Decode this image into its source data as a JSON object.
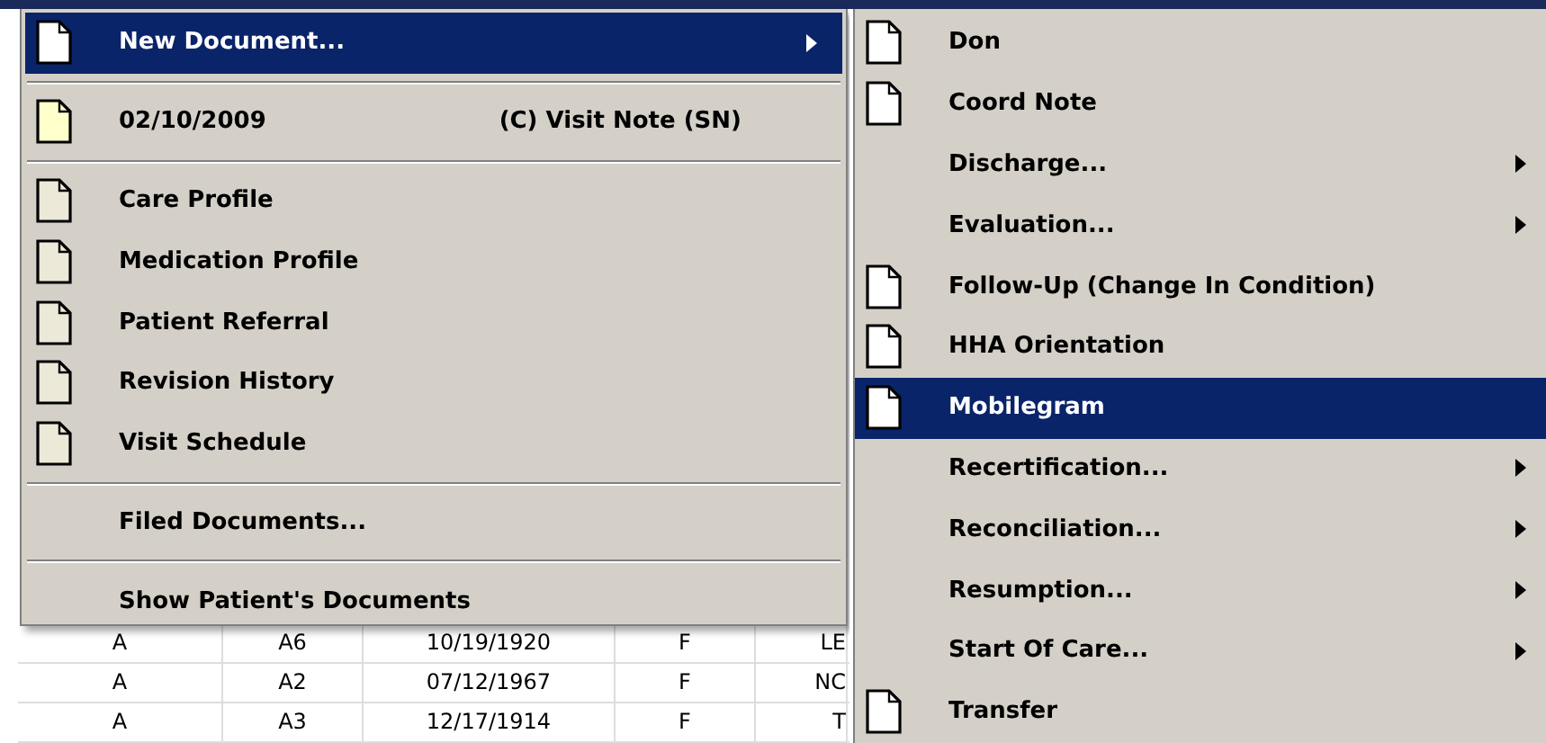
{
  "main_menu": {
    "items": [
      {
        "kind": "item",
        "label": "New Document...",
        "color": "#ffffff",
        "submenu": true,
        "selected": true
      },
      {
        "kind": "separator"
      },
      {
        "kind": "item",
        "label": "02/10/2009",
        "detail": "(C) Visit Note (SN)",
        "color": "#ffffcc",
        "submenu": false,
        "selected": false
      },
      {
        "kind": "separator"
      },
      {
        "kind": "item",
        "label": "Care Profile",
        "color": "#ece9d8",
        "submenu": false,
        "selected": false
      },
      {
        "kind": "item",
        "label": "Medication Profile",
        "color": "#ece9d8",
        "submenu": false,
        "selected": false
      },
      {
        "kind": "item",
        "label": "Patient Referral",
        "color": "#ece9d8",
        "submenu": false,
        "selected": false
      },
      {
        "kind": "item",
        "label": "Revision History",
        "color": "#ece9d8",
        "submenu": false,
        "selected": false
      },
      {
        "kind": "item",
        "label": "Visit Schedule",
        "color": "#ece9d8",
        "submenu": false,
        "selected": false
      },
      {
        "kind": "separator"
      },
      {
        "kind": "item",
        "label": "Filed Documents...",
        "submenu": false,
        "selected": false
      },
      {
        "kind": "separator"
      },
      {
        "kind": "item",
        "label": "Show Patient's Documents",
        "submenu": false,
        "selected": false
      }
    ]
  },
  "submenu": {
    "items": [
      {
        "kind": "item",
        "label": "Don",
        "color": "#ffffff",
        "submenu": false,
        "selected": false
      },
      {
        "kind": "item",
        "label": "Coord Note",
        "color": "#ffffff",
        "submenu": false,
        "selected": false
      },
      {
        "kind": "item",
        "label": "Discharge...",
        "submenu": true,
        "selected": false
      },
      {
        "kind": "item",
        "label": "Evaluation...",
        "submenu": true,
        "selected": false
      },
      {
        "kind": "item",
        "label": "Follow-Up (Change In Condition)",
        "color": "#ffffff",
        "submenu": false,
        "selected": false
      },
      {
        "kind": "item",
        "label": "HHA Orientation",
        "color": "#ffffff",
        "submenu": false,
        "selected": false
      },
      {
        "kind": "item",
        "label": "Mobilegram",
        "color": "#ffffff",
        "submenu": false,
        "selected": true
      },
      {
        "kind": "item",
        "label": "Recertification...",
        "submenu": true,
        "selected": false
      },
      {
        "kind": "item",
        "label": "Reconciliation...",
        "submenu": true,
        "selected": false
      },
      {
        "kind": "item",
        "label": "Resumption...",
        "submenu": true,
        "selected": false
      },
      {
        "kind": "item",
        "label": "Start Of Care...",
        "submenu": true,
        "selected": false
      },
      {
        "kind": "item",
        "label": "Transfer",
        "color": "#ffffff",
        "submenu": false,
        "selected": false
      }
    ]
  },
  "table": {
    "rows": [
      {
        "cells": [
          "A",
          "A6",
          "10/19/1920",
          "F",
          "LE"
        ]
      },
      {
        "cells": [
          "A",
          "A2",
          "07/12/1967",
          "F",
          "NC"
        ]
      },
      {
        "cells": [
          "A",
          "A3",
          "12/17/1914",
          "F",
          "T"
        ]
      }
    ]
  }
}
